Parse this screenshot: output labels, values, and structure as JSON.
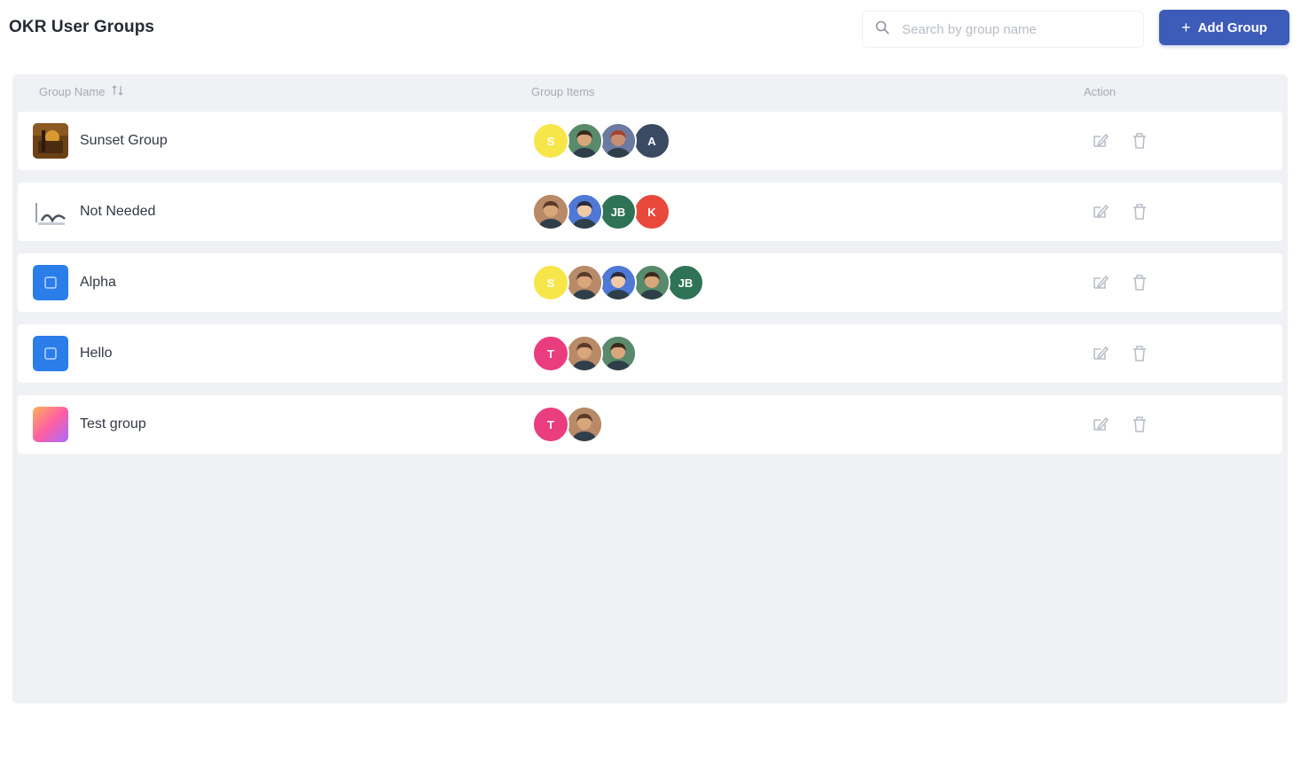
{
  "header": {
    "title": "OKR User Groups",
    "search_placeholder": "Search by group name",
    "add_label": "Add Group",
    "add_icon": "+"
  },
  "table": {
    "columns": {
      "name": "Group Name",
      "items": "Group Items",
      "action": "Action"
    },
    "rows": [
      {
        "name": "Sunset Group",
        "icon": "photo-thumbnail-warm",
        "members": [
          {
            "kind": "initial",
            "label": "S",
            "color": "#f7e64a"
          },
          {
            "kind": "photo",
            "color": "#5a8a6c",
            "skin": "#d9a67c",
            "hair": "#3a2a1e"
          },
          {
            "kind": "photo",
            "color": "#6b7aa0",
            "skin": "#c98e70",
            "hair": "#a8432e"
          },
          {
            "kind": "initial",
            "label": "A",
            "color": "#3b4a63"
          }
        ]
      },
      {
        "name": "Not Needed",
        "icon": "logo-thumbnail",
        "members": [
          {
            "kind": "photo",
            "color": "#b88a68",
            "skin": "#d9a67c",
            "hair": "#5a3b28"
          },
          {
            "kind": "photo",
            "color": "#4f79d6",
            "skin": "#f0c9a8",
            "hair": "#2b2b3a"
          },
          {
            "kind": "initial",
            "label": "JB",
            "color": "#2f7356"
          },
          {
            "kind": "initial",
            "label": "K",
            "color": "#e8493b"
          }
        ]
      },
      {
        "name": "Alpha",
        "icon": "blue-square",
        "members": [
          {
            "kind": "initial",
            "label": "S",
            "color": "#f7e64a"
          },
          {
            "kind": "photo",
            "color": "#b88a68",
            "skin": "#d9a67c",
            "hair": "#5a3b28"
          },
          {
            "kind": "photo",
            "color": "#4f79d6",
            "skin": "#f0c9a8",
            "hair": "#2b2b3a"
          },
          {
            "kind": "photo",
            "color": "#5a8a6c",
            "skin": "#d9a67c",
            "hair": "#3a2a1e"
          },
          {
            "kind": "initial",
            "label": "JB",
            "color": "#2f7356"
          }
        ]
      },
      {
        "name": "Hello",
        "icon": "blue-square",
        "members": [
          {
            "kind": "initial",
            "label": "T",
            "color": "#ea3d80"
          },
          {
            "kind": "photo",
            "color": "#b88a68",
            "skin": "#d9a67c",
            "hair": "#5a3b28"
          },
          {
            "kind": "photo",
            "color": "#5a8a6c",
            "skin": "#d9a67c",
            "hair": "#3a2a1e"
          }
        ]
      },
      {
        "name": "Test group",
        "icon": "gradient-square",
        "members": [
          {
            "kind": "initial",
            "label": "T",
            "color": "#ea3d80"
          },
          {
            "kind": "photo",
            "color": "#b88a68",
            "skin": "#d9a67c",
            "hair": "#5a3b28"
          }
        ]
      }
    ]
  },
  "icons": {
    "search": "search-icon",
    "sort": "sort-icon",
    "edit": "edit-icon",
    "delete": "trash-icon"
  },
  "colors": {
    "accent": "#3d5bb8",
    "panel": "#eff1f4"
  }
}
